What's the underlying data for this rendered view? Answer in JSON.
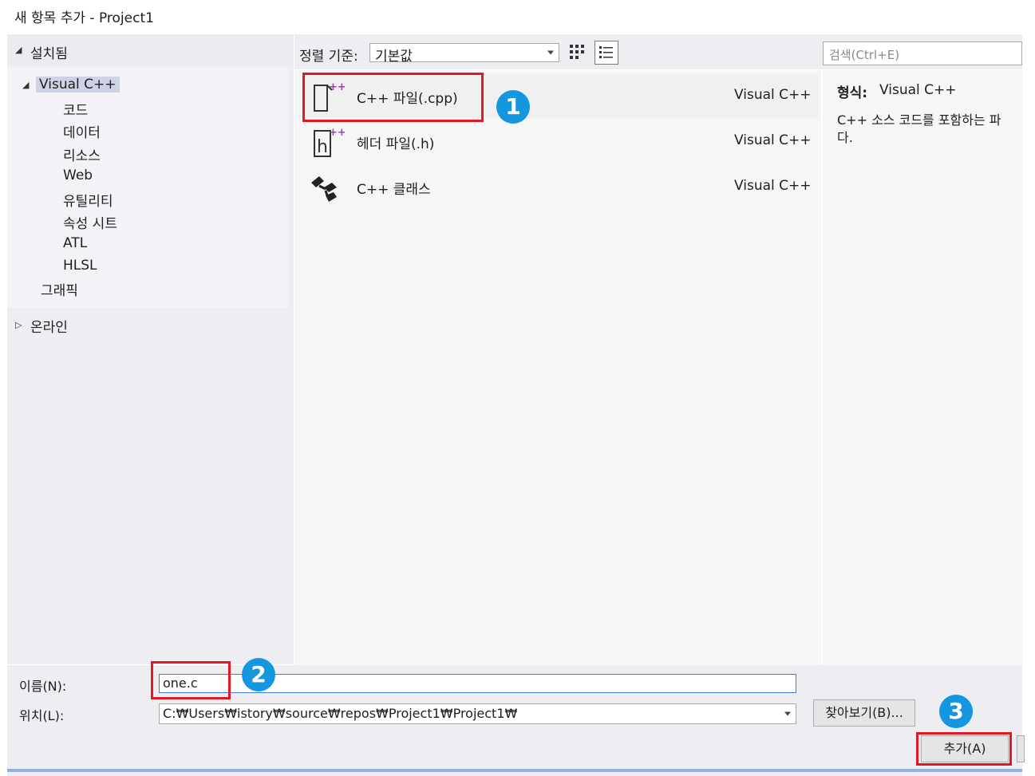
{
  "window": {
    "title": "새 항목 추가 - Project1"
  },
  "sidebar": {
    "installed_label": "설치됨",
    "root_label": "Visual C++",
    "children": [
      "코드",
      "데이터",
      "리소스",
      "Web",
      "유틸리티",
      "속성 시트",
      "ATL",
      "HLSL"
    ],
    "graphics_label": "그래픽",
    "online_label": "온라인"
  },
  "toolbar": {
    "sort_label": "정렬 기준:",
    "sort_value": "기본값",
    "search_placeholder": "검색(Ctrl+E)"
  },
  "items": [
    {
      "name": "C++ 파일(.cpp)",
      "lang": "Visual C++",
      "icon": "cpp-file-icon"
    },
    {
      "name": "헤더 파일(.h)",
      "lang": "Visual C++",
      "icon": "header-file-icon"
    },
    {
      "name": "C++ 클래스",
      "lang": "Visual C++",
      "icon": "cpp-class-icon"
    }
  ],
  "details": {
    "type_label": "형식:",
    "type_value": "Visual C++",
    "description_line1": "C++ 소스 코드를 포함하는 파",
    "description_line2": "다."
  },
  "form": {
    "name_label": "이름(N):",
    "name_value": "one.c",
    "location_label": "위치(L):",
    "location_value": "C:₩Users₩istory₩source₩repos₩Project1₩Project1₩",
    "browse_label": "찾아보기(B)...",
    "add_label": "추가(A)"
  },
  "annotations": {
    "step1": "1",
    "step2": "2",
    "step3": "3",
    "highlight_color": "#e01a22",
    "badge_color": "#1597e0"
  }
}
